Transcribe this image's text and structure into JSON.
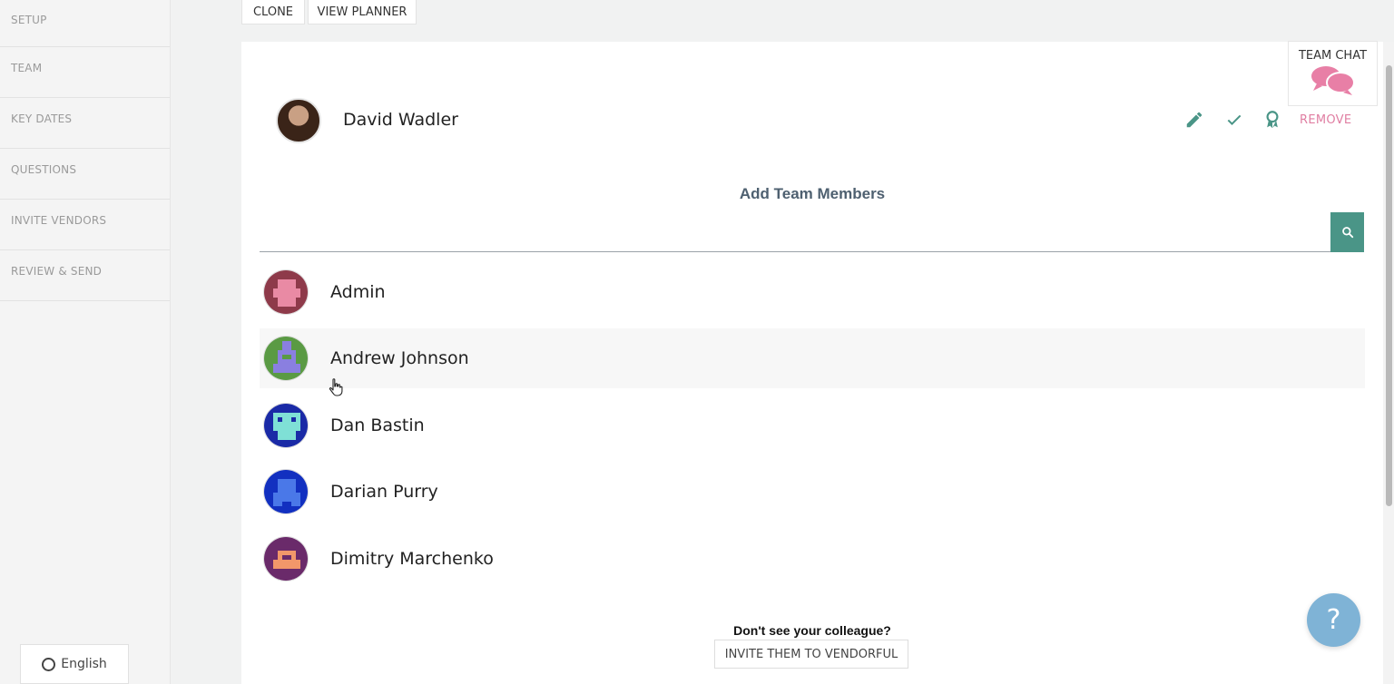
{
  "sidebar": {
    "items": [
      {
        "label": "SETUP"
      },
      {
        "label": "TEAM"
      },
      {
        "label": "KEY DATES"
      },
      {
        "label": "QUESTIONS"
      },
      {
        "label": "INVITE VENDORS"
      },
      {
        "label": "REVIEW & SEND"
      }
    ],
    "language": "English"
  },
  "toolbar": {
    "clone_label": "CLONE",
    "view_planner_label": "VIEW PLANNER"
  },
  "owner": {
    "name": "David Wadler",
    "remove_label": "REMOVE"
  },
  "add_members": {
    "title": "Add Team Members",
    "search_value": "",
    "search_placeholder": ""
  },
  "members": [
    {
      "name": "Admin"
    },
    {
      "name": "Andrew Johnson"
    },
    {
      "name": "Dan Bastin"
    },
    {
      "name": "Darian Purry"
    },
    {
      "name": "Dimitry Marchenko"
    }
  ],
  "footer": {
    "question": "Don't see your colleague?",
    "invite_label": "INVITE THEM TO VENDORFUL"
  },
  "team_chat": {
    "label": "TEAM CHAT"
  },
  "help": {
    "label": "?"
  },
  "colors": {
    "accent_teal": "#4a9587",
    "remove_pink": "#e07ea2",
    "chat_pink": "#e87fa6",
    "help_blue": "#7fb3d6"
  }
}
